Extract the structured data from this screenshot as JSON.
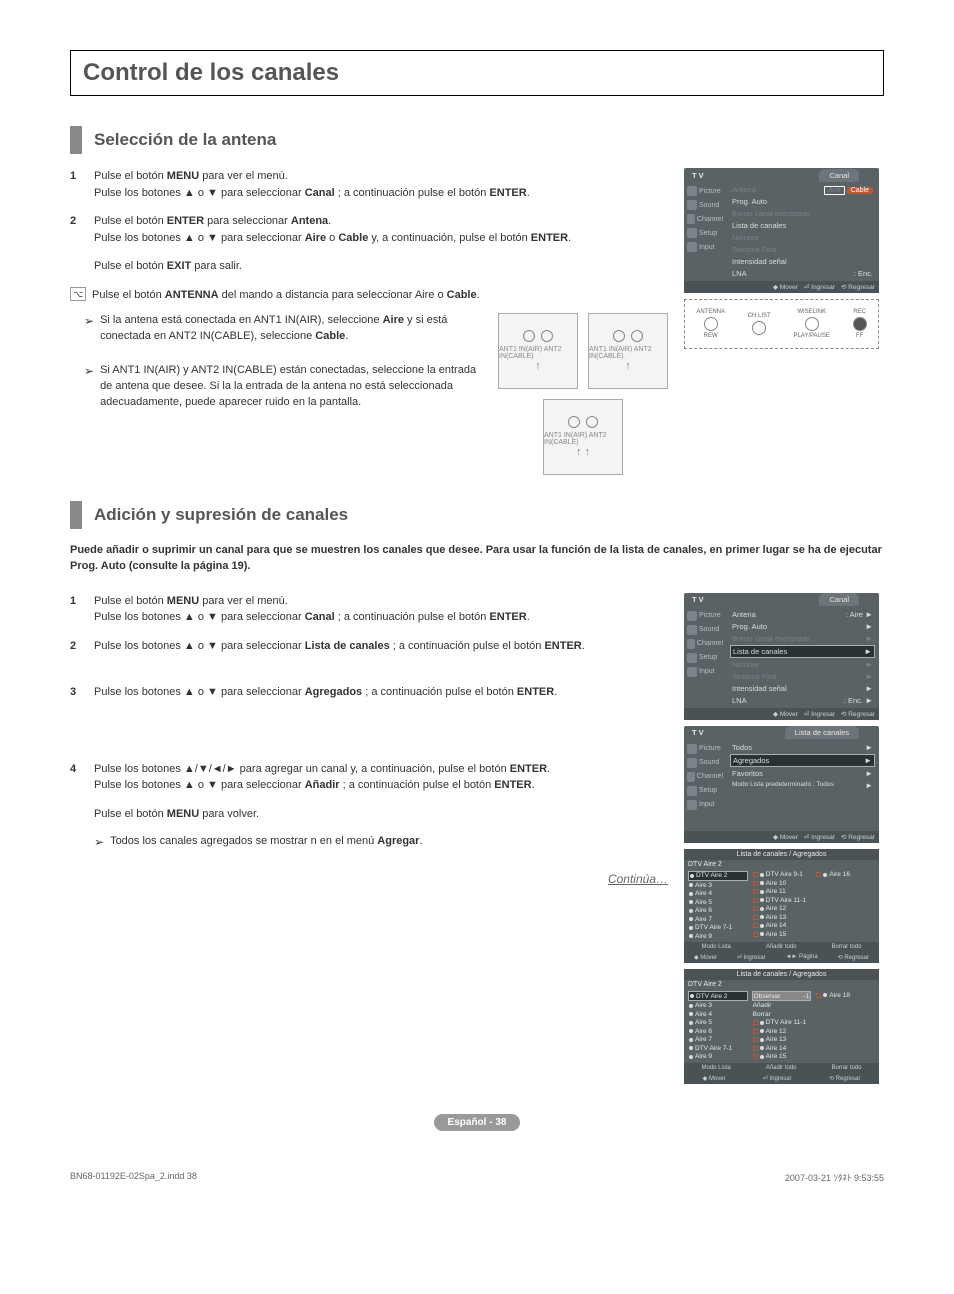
{
  "pageTitle": "Control de los canales",
  "sections": {
    "antenna": {
      "title": "Selección de la antena",
      "steps": {
        "s1num": "1",
        "s1a": "Pulse el botón ",
        "s1b": "MENU",
        "s1c": " para ver el menú.",
        "s1d": "Pulse los botones ▲ o ▼ para seleccionar ",
        "s1e": "Canal",
        "s1f": " ; a continuación pulse el botón ",
        "s1g": "ENTER",
        "s1h": ".",
        "s2num": "2",
        "s2a": "Pulse el botón ",
        "s2b": "ENTER",
        "s2c": " para seleccionar ",
        "s2d": "Antena",
        "s2e": ".",
        "s2f": "Pulse los botones ▲ o ▼ para seleccionar ",
        "s2g": "Aire",
        "s2h": " o ",
        "s2i": "Cable",
        "s2j": " y, a continuación, pulse el botón ",
        "s2k": "ENTER",
        "s2l": ".",
        "exit_a": "Pulse el botón ",
        "exit_b": "EXIT",
        "exit_c": " para salir.",
        "note_a": "Pulse el botón ",
        "note_b": "ANTENNA",
        "note_c": " del mando a distancia para seleccionar Aire o ",
        "note_d": "Cable",
        "note_e": "."
      },
      "tips": {
        "t1": "Si la antena está conectada en ANT1 IN(AIR), seleccione ",
        "t1b": "Aire",
        "t1c": " y si está conectada en ANT2 IN(CABLE), seleccione ",
        "t1d": "Cable",
        "t1e": ".",
        "t2": "Si ANT1 IN(AIR) y ANT2 IN(CABLE) están conectadas, seleccione la entrada de antena que desee. Si la la entrada de la antena no está seleccionada adecuadamente, puede aparecer ruido en la pantalla."
      }
    },
    "add": {
      "title": "Adición y supresión de canales",
      "intro": "Puede añadir o suprimir un canal para que se muestren los canales que desee. Para usar la función de la lista de canales, en primer lugar se ha de ejecutar Prog. Auto (consulte la página 19).",
      "steps": {
        "s1num": "1",
        "s1a": "Pulse el botón ",
        "s1b": "MENU",
        "s1c": " para ver el menú.",
        "s1d": "Pulse los botones ▲ o ▼ para seleccionar ",
        "s1e": "Canal",
        "s1f": " ; a continuación pulse el botón ",
        "s1g": "ENTER",
        "s1h": ".",
        "s2num": "2",
        "s2a": "Pulse los botones ▲ o ▼ para seleccionar ",
        "s2b": "Lista de canales",
        "s2c": " ; a continuación pulse el botón ",
        "s2d": "ENTER",
        "s2e": ".",
        "s3num": "3",
        "s3a": "Pulse los botones ▲ o ▼ para seleccionar ",
        "s3b": "Agregados",
        "s3c": " ; a continuación pulse el botón ",
        "s3d": "ENTER",
        "s3e": ".",
        "s4num": "4",
        "s4a": "Pulse los botones ▲/▼/◄/► para agregar un canal y, a continuación, pulse el botón ",
        "s4b": "ENTER",
        "s4c": ".",
        "s4d": "Pulse los botones ▲ o ▼ para seleccionar ",
        "s4e": "Añadir",
        "s4f": " ; a continuación pulse el botón ",
        "s4g": "ENTER",
        "s4h": ".",
        "menuback_a": "Pulse el botón ",
        "menuback_b": "MENU",
        "menuback_c": " para volver.",
        "tip": "Todos los canales agregados se mostrar n en el menú ",
        "tipb": "Agregar",
        "tipc": "."
      }
    }
  },
  "osd": {
    "tv": "T V",
    "tab": "Canal",
    "side": [
      "Picture",
      "Sound",
      "Channel",
      "Setup",
      "Input"
    ],
    "menu1": {
      "antena": "Antena",
      "aire": "Aire",
      "cable": "Cable",
      "prog": "Prog. Auto",
      "borrar": "Borrar canal encriptado",
      "lista": "Lista de canales",
      "nombre": "Nombre",
      "sintonia": "Sintonía Fina",
      "intensidad": "Intensidad señal",
      "lna": "LNA",
      "enc": ": Enc."
    },
    "menu2": {
      "antena": "Antena",
      "antval": ": Aire"
    },
    "listTab": "Lista de canales",
    "listMenu": {
      "todos": "Todos",
      "agregados": "Agregados",
      "fav": "Favoritos",
      "modo": "Modo Lista predeterminado : Todos"
    },
    "foot": {
      "mover": "Mover",
      "ingresar": "Ingresar",
      "regresar": "Regresar",
      "pagina": "Página"
    },
    "chlist": {
      "title": "Lista de canales / Agregados",
      "hdr": "DTV Aire 2",
      "col1": [
        "DTV Aire 2",
        "Aire 3",
        "Aire 4",
        "Aire 5",
        "Aire 6",
        "Aire 7",
        "DTV Aire 7-1",
        "Aire 9"
      ],
      "col2": [
        "DTV Aire 9-1",
        "Aire 10",
        "Aire 11",
        "DTV Aire 11-1",
        "Aire 12",
        "Aire 13",
        "Aire 14",
        "Aire 15"
      ],
      "col3": [
        "Aire 16"
      ],
      "modolista": "Modo Lista",
      "anadir": "Añadir todo",
      "borrar": "Borrar todo"
    },
    "chlist2": {
      "observar": "Observar",
      "anadir": "Añadir",
      "borrar": "Borrar",
      "col3": [
        "Aire 18"
      ]
    },
    "remote": {
      "antenna": "ANTENNA",
      "chlist": "CH LIST",
      "wiselink": "WISELINK",
      "rec": "REC",
      "rew": "REW",
      "playpause": "PLAY/PAUSE",
      "ff": "FF"
    }
  },
  "continue": "Continúa…",
  "footer": "Español - 38",
  "docMeta": {
    "file": "BN68-01192E-02Spa_2.indd   38",
    "timestamp": "2007-03-21   ｿﾀﾈﾄ 9:53:55"
  }
}
